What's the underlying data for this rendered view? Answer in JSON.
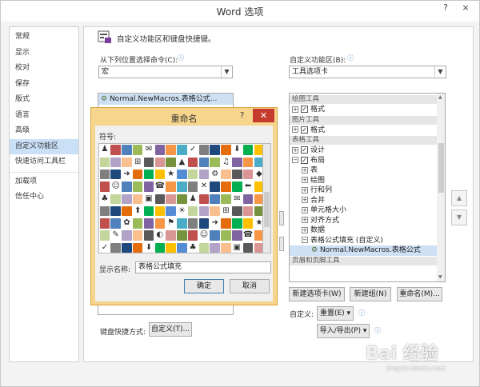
{
  "window": {
    "title": "Word 选项",
    "help": "?",
    "close": "×"
  },
  "sidebar": {
    "items": [
      {
        "label": "常规"
      },
      {
        "label": "显示"
      },
      {
        "label": "校对"
      },
      {
        "label": "保存"
      },
      {
        "label": "版式"
      },
      {
        "label": "语言"
      },
      {
        "label": "高级"
      },
      {
        "label": "自定义功能区",
        "active": true
      },
      {
        "label": "快速访问工具栏"
      },
      {
        "label": "加载项"
      },
      {
        "label": "信任中心"
      }
    ]
  },
  "main": {
    "heading": "自定义功能区和键盘快捷键。",
    "choose_label": "从下列位置选择命令(C):",
    "choose_value": "宏",
    "left_list": {
      "item": "Normal.NewMacros.表格公式..."
    },
    "customize_label": "自定义功能区(B):",
    "customize_value": "工具选项卡",
    "tree": {
      "sections": [
        {
          "header": "绘图工具",
          "rows": [
            {
              "label": "格式",
              "expander": "+",
              "checked": true
            }
          ]
        },
        {
          "header": "图片工具",
          "rows": [
            {
              "label": "格式",
              "expander": "+",
              "checked": true
            }
          ]
        },
        {
          "header": "表格工具",
          "rows": [
            {
              "label": "设计",
              "expander": "+",
              "checked": true
            },
            {
              "label": "布局",
              "expander": "−",
              "checked": true
            },
            {
              "label": "表",
              "expander": "+",
              "level": 2
            },
            {
              "label": "绘图",
              "expander": "+",
              "level": 2
            },
            {
              "label": "行和列",
              "expander": "+",
              "level": 2
            },
            {
              "label": "合并",
              "expander": "+",
              "level": 2
            },
            {
              "label": "单元格大小",
              "expander": "+",
              "level": 2
            },
            {
              "label": "对齐方式",
              "expander": "+",
              "level": 2
            },
            {
              "label": "数据",
              "expander": "+",
              "level": 2
            },
            {
              "label": "表格公式填充 (自定义)",
              "expander": "−",
              "level": 2
            },
            {
              "label": "Normal.NewMacros.表格公式",
              "level": 3,
              "selected": true
            }
          ]
        },
        {
          "header": "页眉和页脚工具",
          "rows": []
        }
      ]
    },
    "buttons": {
      "new_tab": "新建选项卡(W)",
      "new_group": "新建组(N)",
      "rename": "重命名(M)...",
      "customize_label": "自定义:",
      "reset": "重置(E) ▾",
      "import_export": "导入/导出(P) ▾",
      "keyboard_label": "键盘快捷方式:",
      "keyboard_btn": "自定义(T)..."
    },
    "arrows": {
      "up": "▲",
      "down": "▼"
    }
  },
  "dialog": {
    "title": "重命名",
    "help": "?",
    "close": "✕",
    "symbol_label": "符号:",
    "display_name_label": "显示名称:",
    "display_name_value": "表格公式填充",
    "ok": "确定",
    "cancel": "取消"
  },
  "watermark": {
    "text": "Bai 经验",
    "sub": "jingyan.baidu.com"
  }
}
